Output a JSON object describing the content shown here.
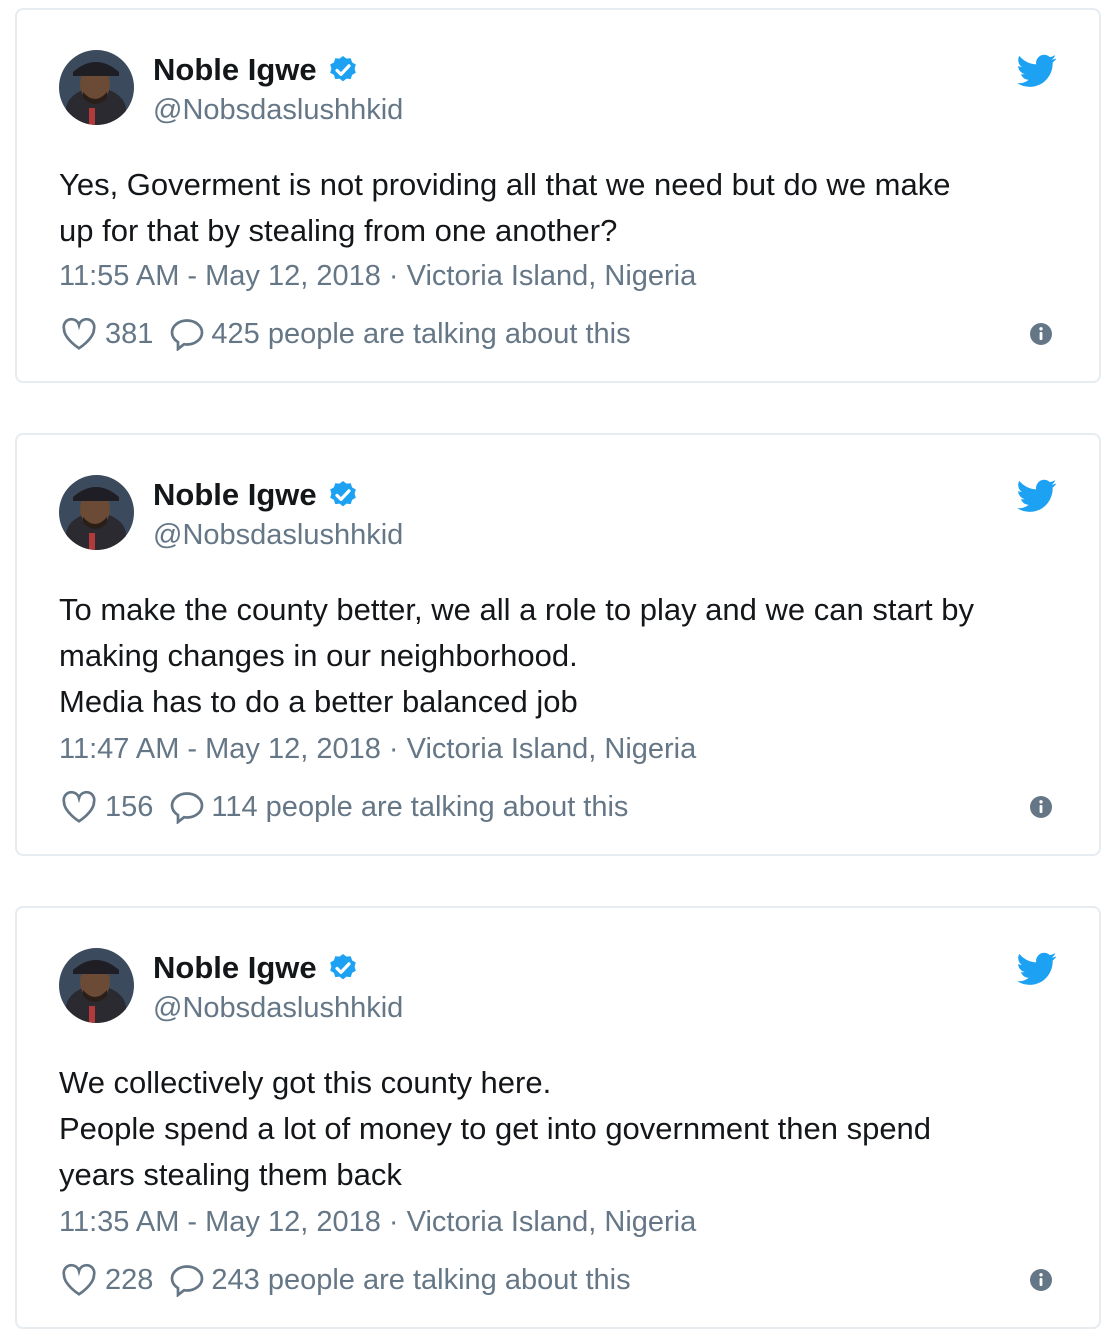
{
  "colors": {
    "twitter_blue": "#1da1f2",
    "text_primary": "#14171a",
    "text_secondary": "#657786",
    "border": "#e6ecf0"
  },
  "icons": {
    "verified": "verified-badge-icon",
    "logo": "twitter-bird-icon",
    "like": "heart-icon",
    "reply": "speech-bubble-icon",
    "info": "info-icon"
  },
  "tweets": [
    {
      "name": "Noble Igwe",
      "handle": "@Nobsdaslushhkid",
      "text": "Yes, Goverment is not providing all that we need but do we make\nup for that by stealing from one another?",
      "meta": "11:55 AM - May 12, 2018 · Victoria Island, Nigeria",
      "likes": "381",
      "talking": "425 people are talking about this"
    },
    {
      "name": "Noble Igwe",
      "handle": "@Nobsdaslushhkid",
      "text": "To make the county better, we all a role to play and we can start by\nmaking changes in our neighborhood.\nMedia has to do a better balanced job",
      "meta": "11:47 AM - May 12, 2018 · Victoria Island, Nigeria",
      "likes": "156",
      "talking": "114 people are talking about this"
    },
    {
      "name": "Noble Igwe",
      "handle": "@Nobsdaslushhkid",
      "text": "We collectively got this county here.\nPeople spend a lot of money to get into government then spend\nyears stealing them back",
      "meta": "11:35 AM - May 12, 2018 · Victoria Island, Nigeria",
      "likes": "228",
      "talking": "243 people are talking about this"
    }
  ]
}
